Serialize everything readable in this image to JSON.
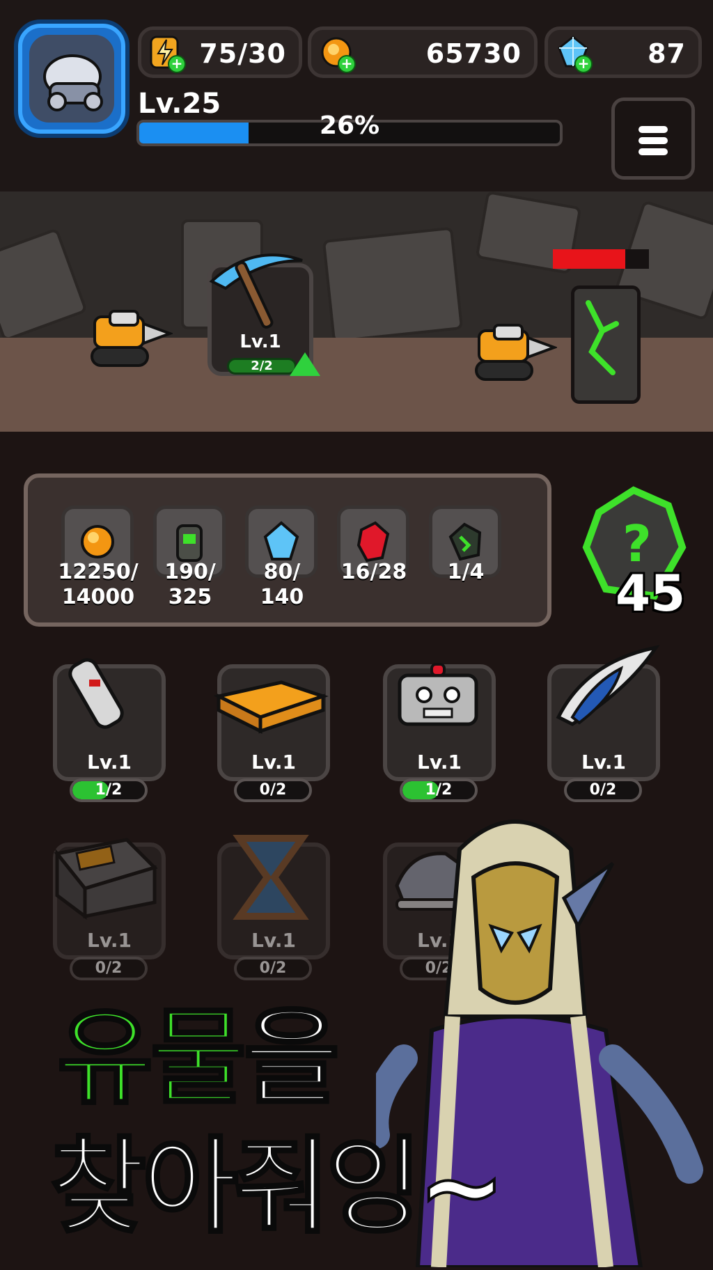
{
  "header": {
    "energy": "75/30",
    "gold": "65730",
    "gems": "87",
    "level": "Lv.25",
    "xp_percent": "26%",
    "xp_fraction": 0.26
  },
  "scene": {
    "pickaxe": {
      "level": "Lv.1",
      "progress": "2/2"
    },
    "enemy_hp_fraction": 0.75
  },
  "inventory": {
    "items": [
      {
        "name": "gold-ore",
        "count": "12250/\n14000"
      },
      {
        "name": "battery",
        "count": "190/\n325"
      },
      {
        "name": "blue-gem",
        "count": "80/\n140"
      },
      {
        "name": "red-crystal",
        "count": "16/28"
      },
      {
        "name": "green-ore",
        "count": "1/4"
      }
    ],
    "mystery_count": "45"
  },
  "relics": [
    {
      "level": "Lv.1",
      "progress": "1/2",
      "fill": 0.5
    },
    {
      "level": "Lv.1",
      "progress": "0/2",
      "fill": 0
    },
    {
      "level": "Lv.1",
      "progress": "1/2",
      "fill": 0.5
    },
    {
      "level": "Lv.1",
      "progress": "0/2",
      "fill": 0
    },
    {
      "level": "Lv.1",
      "progress": "0/2",
      "fill": 0
    },
    {
      "level": "Lv.1",
      "progress": "0/2",
      "fill": 0
    },
    {
      "level": "Lv.1",
      "progress": "0/2",
      "fill": 0
    }
  ],
  "promo": {
    "line1_green": "유물",
    "line1_white": "을",
    "line2": "찾아줘잉~"
  },
  "colors": {
    "accent_green": "#3ee12a",
    "xp_blue": "#1b8ff2",
    "hp_red": "#e8141a"
  }
}
